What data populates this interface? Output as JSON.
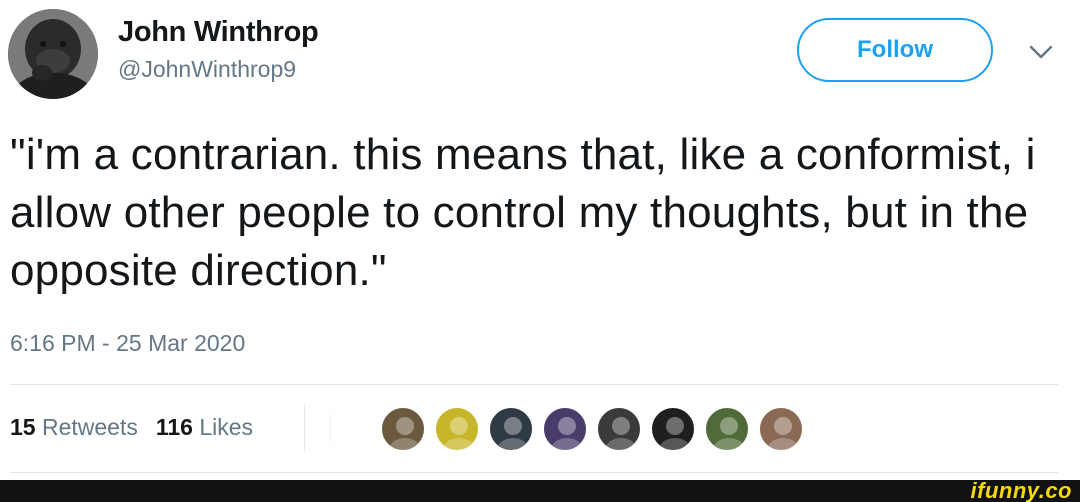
{
  "author": {
    "name": "John Winthrop",
    "handle": "@JohnWinthrop9",
    "avatar_icon": "gorilla-avatar-icon"
  },
  "actions": {
    "follow_label": "Follow",
    "menu_icon": "chevron-down-icon",
    "accent_color": "#1da1f2"
  },
  "tweet": {
    "text": "\"i'm a contrarian. this means that, like a conformist, i allow other people to control my thoughts, but in the opposite direction.\"",
    "timestamp": "6:16 PM - 25 Mar 2020"
  },
  "stats": {
    "retweets_count": "15",
    "retweets_label": "Retweets",
    "likes_count": "116",
    "likes_label": "Likes"
  },
  "likers": [
    {
      "icon": "liker-avatar-icon",
      "color": "#6b5a3e"
    },
    {
      "icon": "liker-avatar-icon",
      "color": "#c8b62a"
    },
    {
      "icon": "liker-avatar-icon",
      "color": "#2f3a44"
    },
    {
      "icon": "liker-avatar-icon",
      "color": "#4a3c6a"
    },
    {
      "icon": "liker-avatar-icon",
      "color": "#3a3a3a"
    },
    {
      "icon": "liker-avatar-icon",
      "color": "#1f1f1f"
    },
    {
      "icon": "liker-avatar-icon",
      "color": "#4f6b3a"
    },
    {
      "icon": "liker-avatar-icon",
      "color": "#8a6a55"
    }
  ],
  "watermark": "ifunny.co"
}
